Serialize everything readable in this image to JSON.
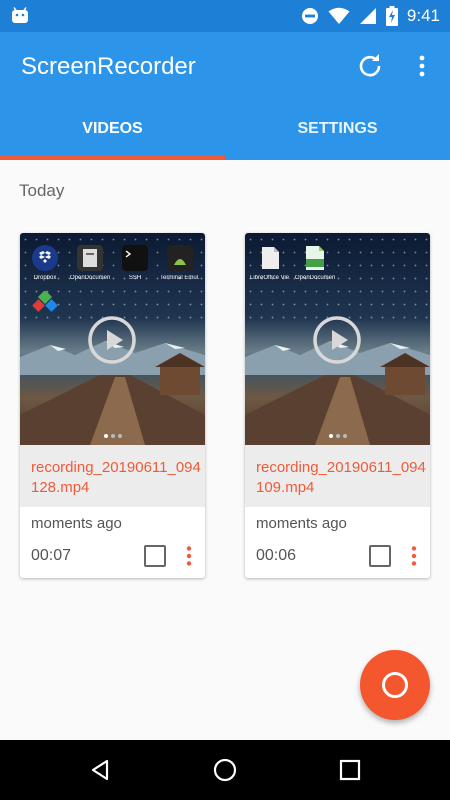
{
  "status_bar": {
    "time": "9:41",
    "icons": [
      "android-icon",
      "do-not-disturb-icon",
      "wifi-icon",
      "signal-icon",
      "battery-charging-icon"
    ]
  },
  "app_bar": {
    "title": "ScreenRecorder",
    "actions": [
      "refresh-icon",
      "more-vert-icon"
    ],
    "tabs": [
      {
        "label": "VIDEOS",
        "selected": true
      },
      {
        "label": "SETTINGS",
        "selected": false
      }
    ]
  },
  "section": {
    "label": "Today"
  },
  "videos": [
    {
      "file_name": "recording_20190611_094128.mp4",
      "time_ago": "moments ago",
      "duration": "00:07",
      "thumbnail_apps": [
        "Dropbox",
        "OpenDocumen...",
        "SSH",
        "Terminal Emul..."
      ]
    },
    {
      "file_name": "recording_20190611_094109.mp4",
      "time_ago": "moments ago",
      "duration": "00:06",
      "thumbnail_apps": [
        "LibreOffice Vie...",
        "OpenDocumen..."
      ]
    }
  ],
  "fab": {
    "icon": "record-icon"
  },
  "nav_bar": {
    "icons": [
      "back-icon",
      "home-icon",
      "recents-icon"
    ]
  },
  "colors": {
    "primary": "#2c95ea",
    "primary_dark": "#1e7fd6",
    "accent": "#ef5b3a"
  }
}
